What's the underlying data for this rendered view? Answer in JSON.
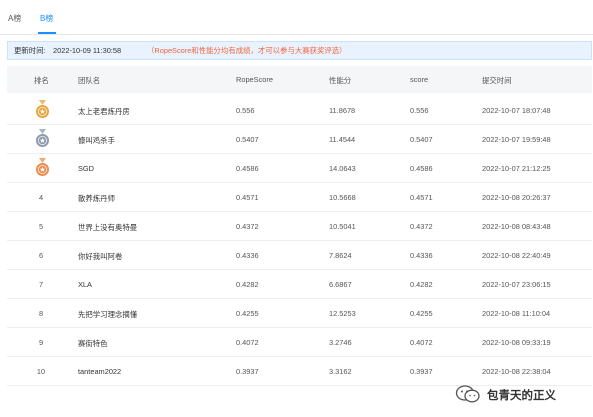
{
  "tabs": [
    {
      "label": "A榜"
    },
    {
      "label": "B榜"
    }
  ],
  "info": {
    "update_label": "更新时间:",
    "update_time": "2022-10-09 11:30:58",
    "note": "（RopeScore和性能分均有成绩，才可以参与大赛获奖评选）"
  },
  "columns": [
    "排名",
    "团队名",
    "RopeScore",
    "性能分",
    "score",
    "提交时间"
  ],
  "rows": [
    {
      "rank": "",
      "medal": "gold-medal-icon",
      "team": "太上老君炼丹房",
      "ropescore": "0.556",
      "perf": "11.8678",
      "score": "0.556",
      "time": "2022-10-07 18:07:48"
    },
    {
      "rank": "",
      "medal": "silver-medal-icon",
      "team": "慷叫鸡杀手",
      "ropescore": "0.5407",
      "perf": "11.4544",
      "score": "0.5407",
      "time": "2022-10-07 19:59:48"
    },
    {
      "rank": "",
      "medal": "bronze-medal-icon",
      "team": "SGD",
      "ropescore": "0.4586",
      "perf": "14.0643",
      "score": "0.4586",
      "time": "2022-10-07 21:12:25"
    },
    {
      "rank": "4",
      "team": "散养炼丹师",
      "ropescore": "0.4571",
      "perf": "10.5668",
      "score": "0.4571",
      "time": "2022-10-08 20:26:37"
    },
    {
      "rank": "5",
      "team": "世界上没有奥特曼",
      "ropescore": "0.4372",
      "perf": "10.5041",
      "score": "0.4372",
      "time": "2022-10-08 08:43:48"
    },
    {
      "rank": "6",
      "team": "你好我叫阿卷",
      "ropescore": "0.4336",
      "perf": "7.8624",
      "score": "0.4336",
      "time": "2022-10-08 22:40:49"
    },
    {
      "rank": "7",
      "team": "XLA",
      "ropescore": "0.4282",
      "perf": "6.6867",
      "score": "0.4282",
      "time": "2022-10-07 23:06:15"
    },
    {
      "rank": "8",
      "team": "先把学习理念摘懂",
      "ropescore": "0.4255",
      "perf": "12.5253",
      "score": "0.4255",
      "time": "2022-10-08 11:10:04"
    },
    {
      "rank": "9",
      "team": "赛街特色",
      "ropescore": "0.4072",
      "perf": "3.2746",
      "score": "0.4072",
      "time": "2022-10-08 09:33:19"
    },
    {
      "rank": "10",
      "team": "tanteam2022",
      "ropescore": "0.3937",
      "perf": "3.3162",
      "score": "0.3937",
      "time": "2022-10-08 22:38:04"
    }
  ],
  "watermark": {
    "text": "包青天的正义",
    "icon": "wechat-icon"
  },
  "colors": {
    "accent": "#1890ff",
    "note": "#f5643b",
    "infobar_bg": "#e8f3ff",
    "header_bg": "#f5f6f8",
    "gold": "#e8a33d",
    "silver": "#8e99ad",
    "bronze": "#ee8a4a"
  }
}
